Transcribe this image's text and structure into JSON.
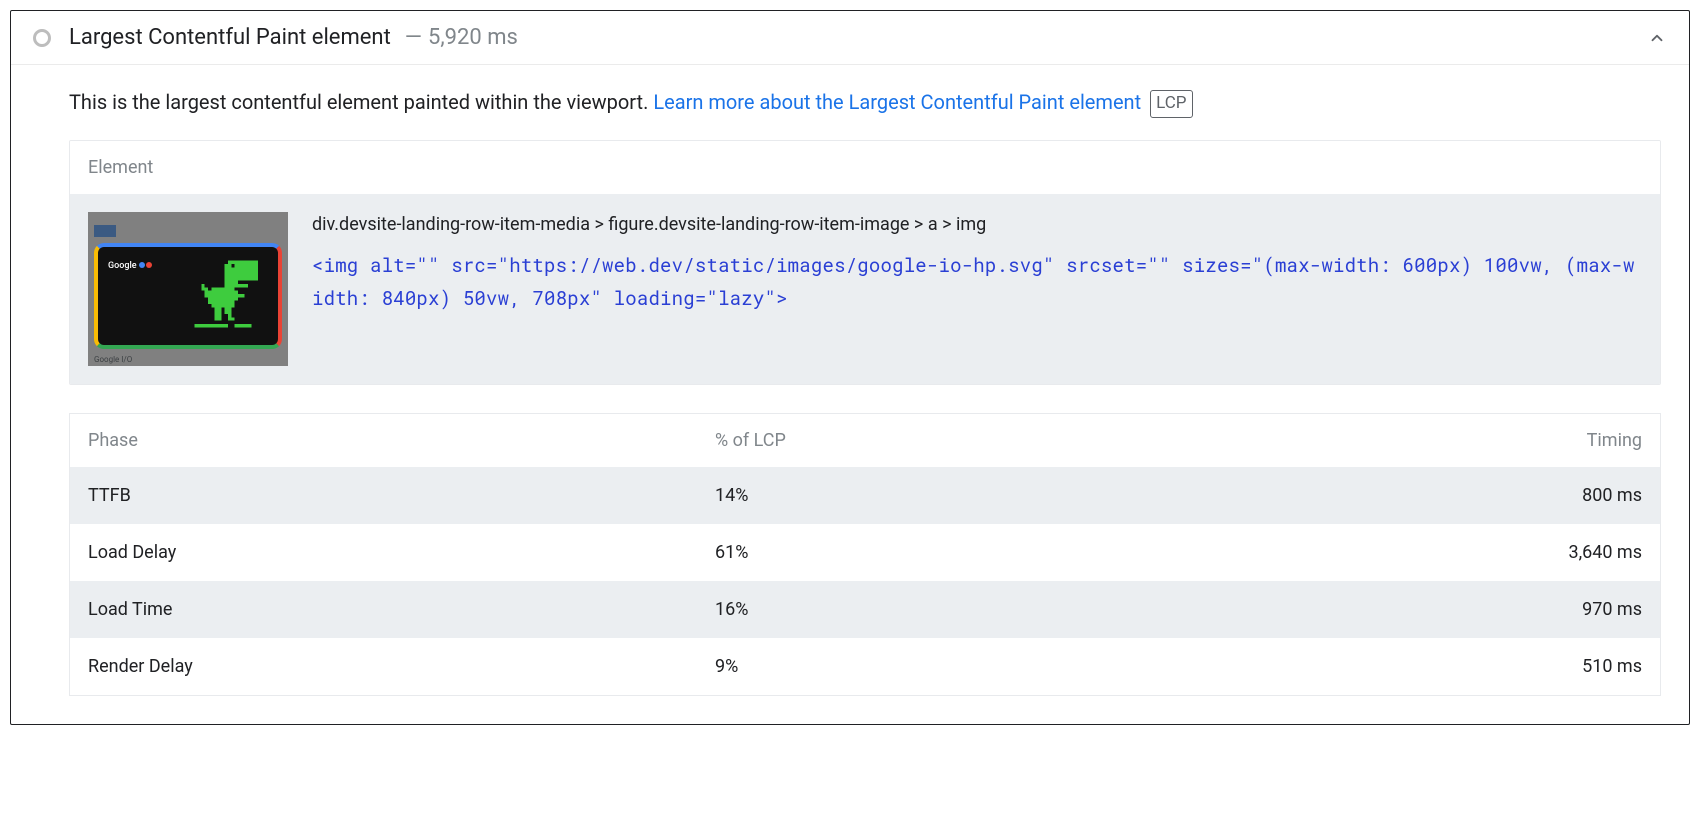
{
  "header": {
    "title": "Largest Contentful Paint element",
    "dash": "—",
    "time": "5,920 ms"
  },
  "description": {
    "text": "This is the largest contentful element painted within the viewport. ",
    "link": "Learn more about the Largest Contentful Paint element",
    "badge": "LCP"
  },
  "element": {
    "header": "Element",
    "selector": "div.devsite-landing-row-item-media > figure.devsite-landing-row-item-image > a > img",
    "html": "<img alt=\"\" src=\"https://web.dev/static/images/google-io-hp.svg\" srcset=\"\" sizes=\"(max-width: 600px) 100vw, (max-width: 840px) 50vw, 708px\" loading=\"lazy\">",
    "thumb_logo": "Google",
    "thumb_caption": "Google I/O"
  },
  "table": {
    "columns": {
      "phase": "Phase",
      "percent": "% of LCP",
      "timing": "Timing"
    },
    "rows": [
      {
        "phase": "TTFB",
        "percent": "14%",
        "timing": "800 ms"
      },
      {
        "phase": "Load Delay",
        "percent": "61%",
        "timing": "3,640 ms"
      },
      {
        "phase": "Load Time",
        "percent": "16%",
        "timing": "970 ms"
      },
      {
        "phase": "Render Delay",
        "percent": "9%",
        "timing": "510 ms"
      }
    ]
  }
}
